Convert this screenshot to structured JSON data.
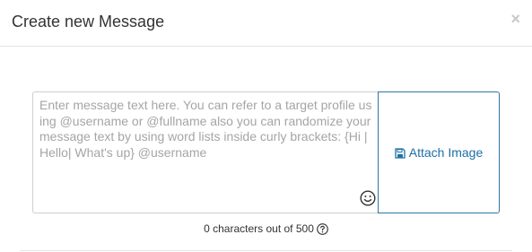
{
  "modal": {
    "title": "Create new Message",
    "close_label": "×"
  },
  "composer": {
    "placeholder": "Enter message text here. You can refer to a target profile using @username or @fullname also you can randomize your message text by using word lists inside curly brackets: {Hi | Hello| What's up} @username",
    "value": "",
    "emoji_icon": "smile-icon",
    "attach_label": "Attach Image",
    "attach_icon": "save-floppy-icon"
  },
  "counter": {
    "text": "0 characters out of 500",
    "help_icon": "question-circle-icon"
  },
  "colors": {
    "accent": "#1d6fa5",
    "attach_border": "#2f75a8",
    "placeholder": "#a5a5a5",
    "border": "#cfcfcf"
  }
}
